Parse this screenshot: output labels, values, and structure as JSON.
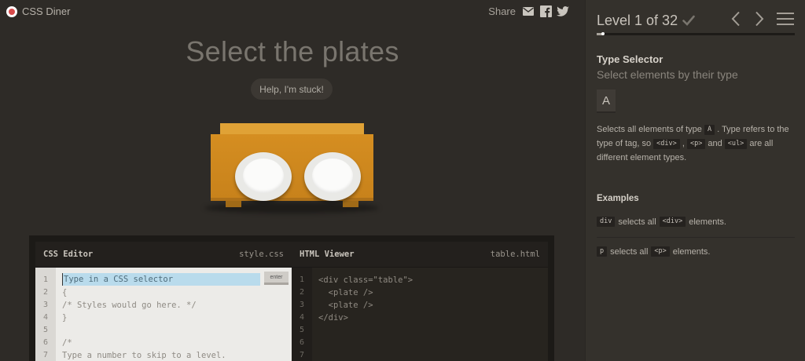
{
  "app": {
    "name": "CSS Diner"
  },
  "share": {
    "label": "Share",
    "icons": [
      "mail-icon",
      "facebook-icon",
      "twitter-icon"
    ]
  },
  "main": {
    "instruction": "Select the plates",
    "help_button": "Help, I'm stuck!"
  },
  "editor": {
    "css": {
      "title": "CSS Editor",
      "file": "style.css",
      "placeholder": "Type in a CSS selector",
      "enter_label": "enter",
      "line_numbers": [
        "1",
        "2",
        "3",
        "4",
        "5",
        "6",
        "7"
      ],
      "lines": [
        "",
        "{",
        "/* Styles would go here. */",
        "}",
        "",
        "/*",
        "Type a number to skip to a level."
      ]
    },
    "html": {
      "title": "HTML Viewer",
      "file": "table.html",
      "line_numbers": [
        "1",
        "2",
        "3",
        "4",
        "5",
        "6",
        "7"
      ],
      "lines": [
        "<div class=\"table\">",
        "  <plate />",
        "  <plate />",
        "</div>",
        "",
        "",
        ""
      ]
    }
  },
  "sidebar": {
    "level_title": "Level 1 of 32",
    "level_current": 1,
    "level_total": 32,
    "selector_name": "Type Selector",
    "title": "Select elements by their type",
    "syntax": "A",
    "hint": {
      "p1": "Selects all elements of type",
      "tag_a": "A",
      "p2": ". Type refers to the type of tag, so",
      "tag_div": "<div>",
      "sep1": ",",
      "tag_p": "<p>",
      "and": "and",
      "tag_ul": "<ul>",
      "p3": "are all different element types."
    },
    "examples_title": "Examples",
    "examples": [
      {
        "code": "div",
        "text1": "selects all",
        "tag": "<div>",
        "text2": "elements."
      },
      {
        "code": "p",
        "text1": "selects all",
        "tag": "<p>",
        "text2": "elements."
      }
    ]
  },
  "colors": {
    "background": "#2e2b27",
    "sidebar": "#34312c",
    "table": "#d58e21",
    "input_highlight": "#b9dbec"
  }
}
